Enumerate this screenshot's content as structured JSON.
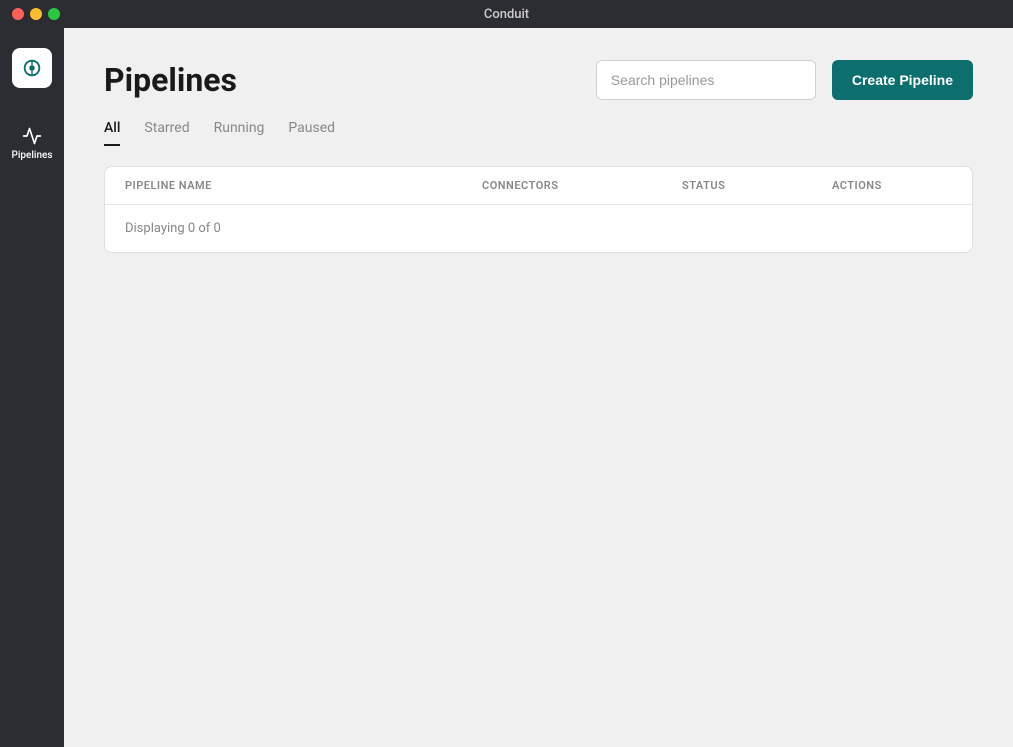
{
  "window": {
    "title": "Conduit"
  },
  "traffic_lights": {
    "close_label": "close",
    "minimize_label": "minimize",
    "maximize_label": "maximize"
  },
  "sidebar": {
    "logo_alt": "Conduit logo",
    "items": [
      {
        "id": "pipelines",
        "label": "Pipelines",
        "active": true
      }
    ]
  },
  "page": {
    "title": "Pipelines",
    "search_placeholder": "Search pipelines",
    "create_button_label": "Create Pipeline",
    "tabs": [
      {
        "id": "all",
        "label": "All",
        "active": true
      },
      {
        "id": "starred",
        "label": "Starred",
        "active": false
      },
      {
        "id": "running",
        "label": "Running",
        "active": false
      },
      {
        "id": "paused",
        "label": "Paused",
        "active": false
      }
    ],
    "table": {
      "columns": [
        {
          "id": "pipeline-name",
          "label": "PIPELINE NAME"
        },
        {
          "id": "connectors",
          "label": "CONNECTORS"
        },
        {
          "id": "status",
          "label": "STATUS"
        },
        {
          "id": "actions",
          "label": "ACTIONS"
        }
      ],
      "display_count": "Displaying 0 of 0",
      "rows": []
    }
  }
}
